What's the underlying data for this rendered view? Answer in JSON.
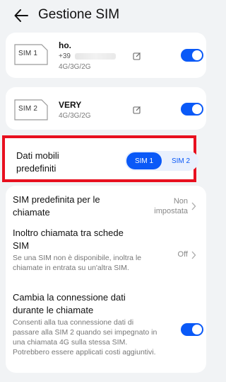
{
  "header": {
    "title": "Gestione SIM"
  },
  "sim1": {
    "badge": "SIM 1",
    "name": "ho.",
    "number_prefix": "+39",
    "network": "4G/3G/2G",
    "enabled": true
  },
  "sim2": {
    "badge": "SIM 2",
    "name": "VERY",
    "network": "4G/3G/2G",
    "enabled": true
  },
  "default_data": {
    "label": "Dati mobili predefiniti",
    "options": [
      "SIM 1",
      "SIM 2"
    ],
    "selected": "SIM 1"
  },
  "settings": {
    "default_call_sim": {
      "title": "SIM predefinita per le chiamate",
      "value": "Non impostata"
    },
    "call_forwarding": {
      "title": "Inoltro chiamata tra schede SIM",
      "description": "Se una SIM non è disponibile, inoltra le chiamate in entrata su un'altra SIM.",
      "value": "Off"
    },
    "switch_data_during_calls": {
      "title": "Cambia la connessione dati durante le chiamate",
      "description": "Consenti alla tua connessione dati di passare alla SIM 2 quando sei impegnato in una chiamata 4G sulla stessa SIM. Potrebbero essere applicati costi aggiuntivi.",
      "enabled": true
    }
  },
  "colors": {
    "accent": "#0a59f7",
    "highlight_border": "#e8101f",
    "background": "#f1f3f5"
  }
}
